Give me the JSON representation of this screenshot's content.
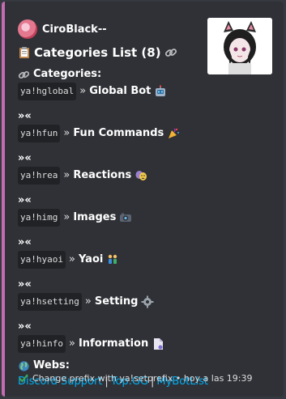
{
  "author": {
    "name": "CiroBlack--"
  },
  "title": {
    "text": "Categories List (8)"
  },
  "categories_heading": "Categories:",
  "separator": "»«",
  "arrow": "»",
  "rows": [
    {
      "cmd": "ya!hglobal",
      "label": "Global Bot"
    },
    {
      "cmd": "ya!hfun",
      "label": "Fun Commands"
    },
    {
      "cmd": "ya!hrea",
      "label": "Reactions"
    },
    {
      "cmd": "ya!himg",
      "label": "Images"
    },
    {
      "cmd": "ya!hyaoi",
      "label": "Yaoi"
    },
    {
      "cmd": "ya!hsetting",
      "label": "Setting"
    },
    {
      "cmd": "ya!hinfo",
      "label": "Information"
    }
  ],
  "webs": {
    "heading": "Webs:",
    "links": [
      "Discord Support",
      "Top.GG",
      "MyBotList"
    ],
    "divider": "|"
  },
  "footer": {
    "text": "Change prefix with ya!setprefix • hoy a las 19:39"
  },
  "colors": {
    "accent": "#c36cb0",
    "link": "#00aff4",
    "background": "#2f3136"
  },
  "icons": [
    "clipboard-icon",
    "link-icon",
    "robot-icon",
    "party-popper-icon",
    "theater-masks-icon",
    "camera-icon",
    "couple-icon",
    "gear-icon",
    "document-icon",
    "globe-icon",
    "check-icon"
  ]
}
